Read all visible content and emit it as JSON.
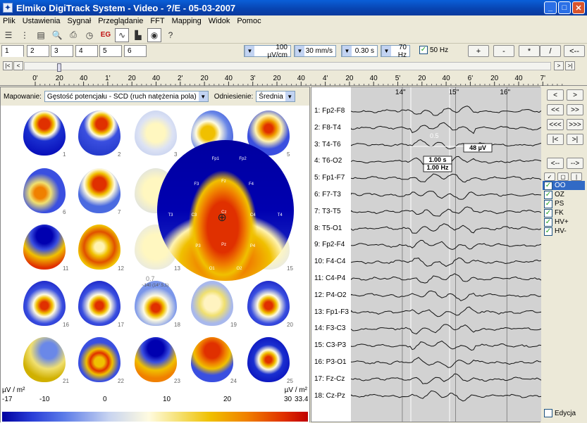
{
  "window": {
    "title": "Elmiko DigiTrack System  -  Video  -  ?/E  -  05-03-2007"
  },
  "menu": [
    "Plik",
    "Ustawienia",
    "Sygnał",
    "Przeglądanie",
    "FFT",
    "Mapping",
    "Widok",
    "Pomoc"
  ],
  "toolbar": {
    "eg_label": "EG"
  },
  "tabs": [
    "1",
    "2",
    "3",
    "4",
    "5",
    "6"
  ],
  "settings": {
    "sensitivity": "100 µV/cm",
    "speed": "30 mm/s",
    "time_const": "0.30 s",
    "high_filter": "70 Hz",
    "notch_label": "50 Hz",
    "notch_checked": true
  },
  "zoom_buttons": [
    "+",
    "-",
    "*",
    "/",
    "<--"
  ],
  "ruler": {
    "labels": [
      "0'",
      "20",
      "40",
      "1'",
      "20",
      "40",
      "2'",
      "20",
      "40",
      "3'",
      "20",
      "40",
      "4'",
      "20",
      "40",
      "5'",
      "20",
      "40",
      "6'",
      "20",
      "40",
      "7'"
    ]
  },
  "mapping": {
    "label": "Mapowanie:",
    "mode": "Gęstość potencjału - SCD (ruch natężenia pola)",
    "ref_label": "Odniesienie:",
    "ref": "Średnia"
  },
  "maps": {
    "count": 25,
    "big_caption": "0.7",
    "big_sub": "~140 (14°.5,1)"
  },
  "big_electrodes": [
    "Fp1",
    "Fp2",
    "F3",
    "Fz",
    "F4",
    "C3",
    "Cz",
    "C4",
    "T3",
    "T4",
    "P3",
    "Pz",
    "P4",
    "O1",
    "O2"
  ],
  "scale": {
    "unit_left": "µV / m²",
    "unit_right": "µV / m²",
    "ticks": [
      "-17",
      "-10",
      "0",
      "10",
      "20",
      "30",
      "33.4"
    ],
    "colors": {
      "min": "#0000a0",
      "mid": "#fff7c0",
      "max": "#c00000"
    }
  },
  "channels": [
    "1: Fp2-F8",
    "2: F8-T4",
    "3: T4-T6",
    "4: T6-O2",
    "5: Fp1-F7",
    "6: F7-T3",
    "7: T3-T5",
    "8: T5-O1",
    "9: Fp2-F4",
    "10: F4-C4",
    "11: C4-P4",
    "12: P4-O2",
    "13: Fp1-F3",
    "14: F3-C3",
    "15: C3-P3",
    "16: P3-O1",
    "17: Fz-Cz",
    "18: Cz-Pz"
  ],
  "eeg": {
    "time_marks": [
      "14\"",
      "15\"",
      "16\""
    ],
    "annot_value": "0.5",
    "cursor_amp": "48 µV",
    "cursor_time": "1.00 s",
    "cursor_freq": "1.00 Hz"
  },
  "nav": {
    "buttons": [
      "<",
      ">",
      "<<",
      ">>",
      "<<<",
      ">>>",
      "|<",
      ">|",
      "<--",
      "-->"
    ]
  },
  "filters": [
    {
      "label": "OO",
      "checked": true,
      "active": true
    },
    {
      "label": "OZ",
      "checked": true
    },
    {
      "label": "PS",
      "checked": true
    },
    {
      "label": "FK",
      "checked": true
    },
    {
      "label": "HV+",
      "checked": true
    },
    {
      "label": "HV-",
      "checked": true
    }
  ],
  "edit_label": "Edycja"
}
